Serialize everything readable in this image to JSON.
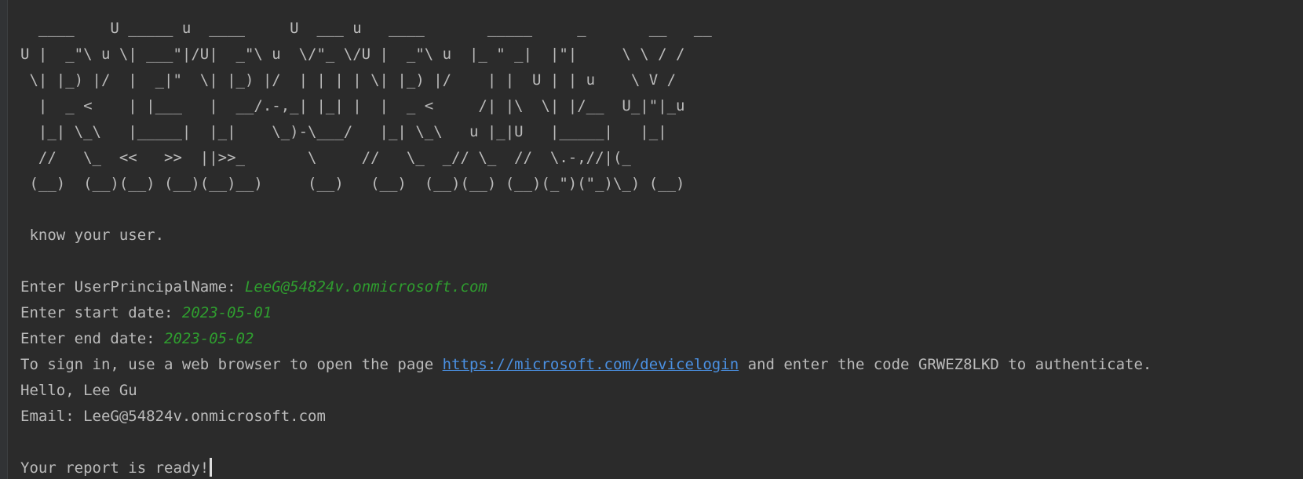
{
  "banner": [
    "  ____    U _____ u  ____     U  ___ u   ____       _____     _       __   __",
    "U |  _\"\\ u \\| ___\"|/U|  _\"\\ u  \\/\"_ \\/U |  _\"\\ u  |_ \" _|  |\"|     \\ \\ / /",
    " \\| |_) |/  |  _|\"  \\| |_) |/  | | | | \\| |_) |/    | |  U | | u    \\ V /",
    "  |  _ <    | |___   |  __/.-,_| |_| |  |  _ <     /| |\\  \\| |/__  U_|\"|_u",
    "  |_| \\_\\   |_____|  |_|    \\_)-\\___/   |_| \\_\\   u |_|U   |_____|   |_|",
    "  //   \\_  <<   >>  ||>>_       \\     //   \\_  _// \\_  //  \\.-,//|(_",
    " (__)  (__)(__) (__)(__)__)     (__)   (__)  (__)(__) (__)(_\")(\"_)\\_) (__)"
  ],
  "tagline": " know your user.",
  "prompts": {
    "upn_label": "Enter UserPrincipalName: ",
    "upn_value": "LeeG@54824v.onmicrosoft.com",
    "start_label": "Enter start date: ",
    "start_value": "2023-05-01",
    "end_label": "Enter end date: ",
    "end_value": "2023-05-02"
  },
  "signin": {
    "prefix": "To sign in, use a web browser to open the page ",
    "url": "https://microsoft.com/devicelogin",
    "suffix": " and enter the code GRWEZ8LKD to authenticate."
  },
  "greeting": "Hello, Lee Gu",
  "email_line": "Email: LeeG@54824v.onmicrosoft.com",
  "final_message": "Your report is ready!",
  "colors": {
    "background": "#2b2b2b",
    "text": "#bbbbbb",
    "user_input": "#2f9e2f",
    "link": "#4a90e2"
  }
}
